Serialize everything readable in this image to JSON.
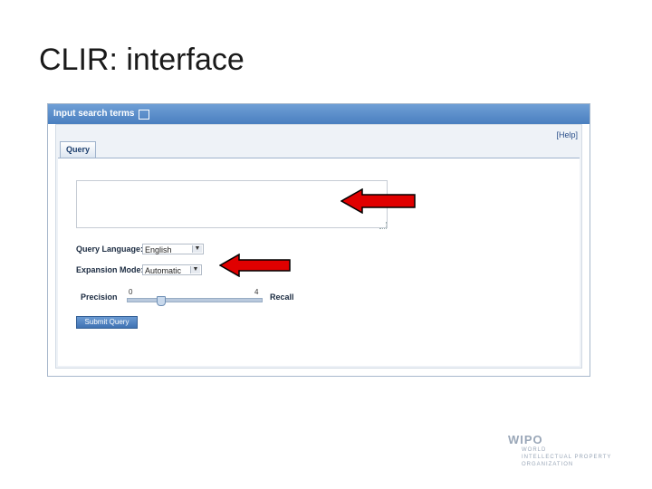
{
  "slide": {
    "title": "CLIR: interface"
  },
  "panel": {
    "header_title": "Input search terms",
    "help_link": "[Help]",
    "tab_label": "Query",
    "query_value": "",
    "query_language_label": "Query Language:",
    "query_language_value": "English",
    "expansion_mode_label": "Expansion Mode:",
    "expansion_mode_value": "Automatic",
    "precision_label": "Precision",
    "recall_label": "Recall",
    "slider_min": "0",
    "slider_max": "4",
    "slider_value": 1,
    "submit_label": "Submit Query"
  },
  "annotations": {
    "arrow_color": "#e00000"
  },
  "logo": {
    "name": "WIPO",
    "line1": "WORLD",
    "line2": "INTELLECTUAL PROPERTY",
    "line3": "ORGANIZATION"
  }
}
